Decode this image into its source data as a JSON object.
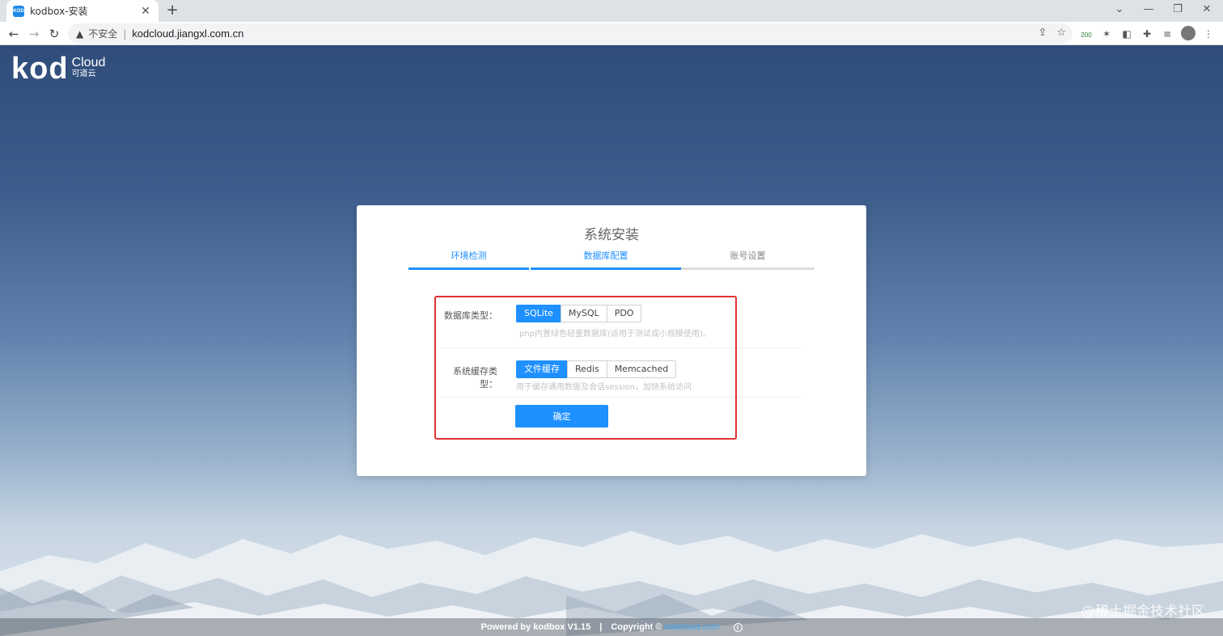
{
  "browser": {
    "tab_title": "kodbox-安装",
    "favicon_text": "KOD",
    "insecure_label": "不安全",
    "url": "kodcloud.jiangxl.com.cn",
    "ext_badge": "200"
  },
  "logo": {
    "brand": "kod",
    "cloud": "Cloud",
    "cn": "可道云"
  },
  "install": {
    "title": "系统安装",
    "steps": [
      {
        "label": "环境检测",
        "state": "done"
      },
      {
        "label": "数据库配置",
        "state": "active"
      },
      {
        "label": "账号设置",
        "state": "pending"
      }
    ],
    "db": {
      "label": "数据库类型：",
      "options": [
        "SQLite",
        "MySQL",
        "PDO"
      ],
      "selected": "SQLite",
      "hint": "php内置绿色轻量数据库(适用于测试或小规模使用)。"
    },
    "cache": {
      "label": "系统缓存类型：",
      "options": [
        "文件缓存",
        "Redis",
        "Memcached"
      ],
      "selected": "文件缓存",
      "hint": "用于缓存通用数据及会话session，加快系统访问"
    },
    "confirm_label": "确定"
  },
  "footer": {
    "powered": "Powered by kodbox V1.15",
    "divider": "|",
    "copyright": "Copyright ©",
    "link": "kodcloud.com",
    "info": "i"
  },
  "watermark": "@稀土掘金技术社区",
  "colors": {
    "accent": "#1e90ff",
    "highlight_box": "#e03131"
  }
}
